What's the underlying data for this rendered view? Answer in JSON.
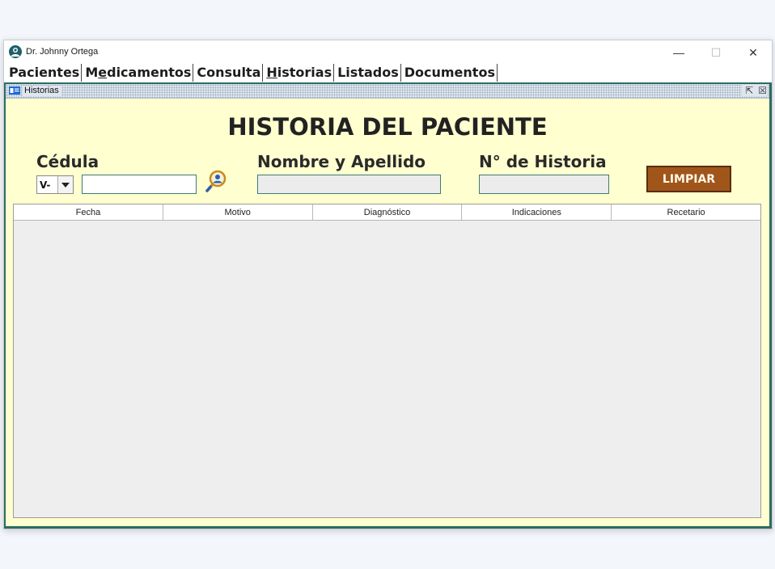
{
  "window": {
    "title": "Dr. Johnny Ortega",
    "controls": {
      "minimize": "—",
      "maximize": "☐",
      "close": "✕"
    }
  },
  "menubar": {
    "items": [
      {
        "pre": "",
        "u": "",
        "post": "Pacientes"
      },
      {
        "pre": "M",
        "u": "e",
        "post": "dicamentos"
      },
      {
        "pre": "",
        "u": "",
        "post": "Consulta"
      },
      {
        "pre": "",
        "u": "H",
        "post": "istorias"
      },
      {
        "pre": "",
        "u": "",
        "post": "Listados"
      },
      {
        "pre": "",
        "u": "",
        "post": "Documentos"
      }
    ]
  },
  "internal_frame": {
    "title": "Historias",
    "controls": {
      "restore": "⇱",
      "close": "☒"
    }
  },
  "form": {
    "heading": "HISTORIA DEL PACIENTE",
    "cedula_label": "Cédula",
    "cedula_prefix": "V-",
    "cedula_value": "",
    "nombre_label": "Nombre y Apellido",
    "nombre_value": "",
    "historia_label": "N° de Historia",
    "historia_value": "",
    "clear_button": "LIMPIAR"
  },
  "table": {
    "columns": [
      "Fecha",
      "Motivo",
      "Diagnóstico",
      "Indicaciones",
      "Recetario"
    ],
    "rows": []
  },
  "icons": {
    "app": "doctor-avatar-icon",
    "frame": "id-card-icon",
    "search": "magnifier-user-icon"
  },
  "colors": {
    "frame_background": "#ffffd0",
    "desktop": "#2d6a63",
    "clear_button": "#a0561a"
  }
}
